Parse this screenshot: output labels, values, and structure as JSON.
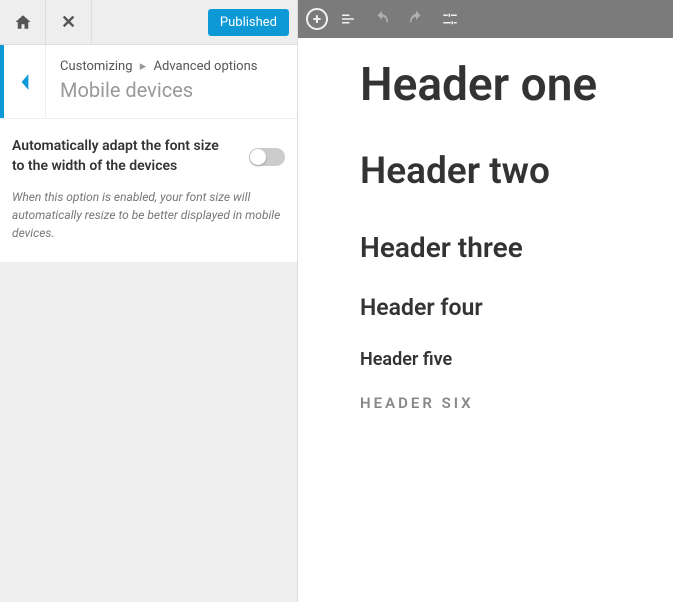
{
  "top": {
    "publish_label": "Published"
  },
  "breadcrumb": {
    "root": "Customizing",
    "section": "Advanced options",
    "title": "Mobile devices"
  },
  "setting": {
    "label": "Automatically adapt the font size to the width of the devices",
    "description": "When this option is enabled, your font size will automatically resize to be better displayed in mobile devices.",
    "enabled": false
  },
  "preview": {
    "h1": "Header one",
    "h2": "Header two",
    "h3": "Header three",
    "h4": "Header four",
    "h5": "Header five",
    "h6": "HEADER SIX"
  }
}
